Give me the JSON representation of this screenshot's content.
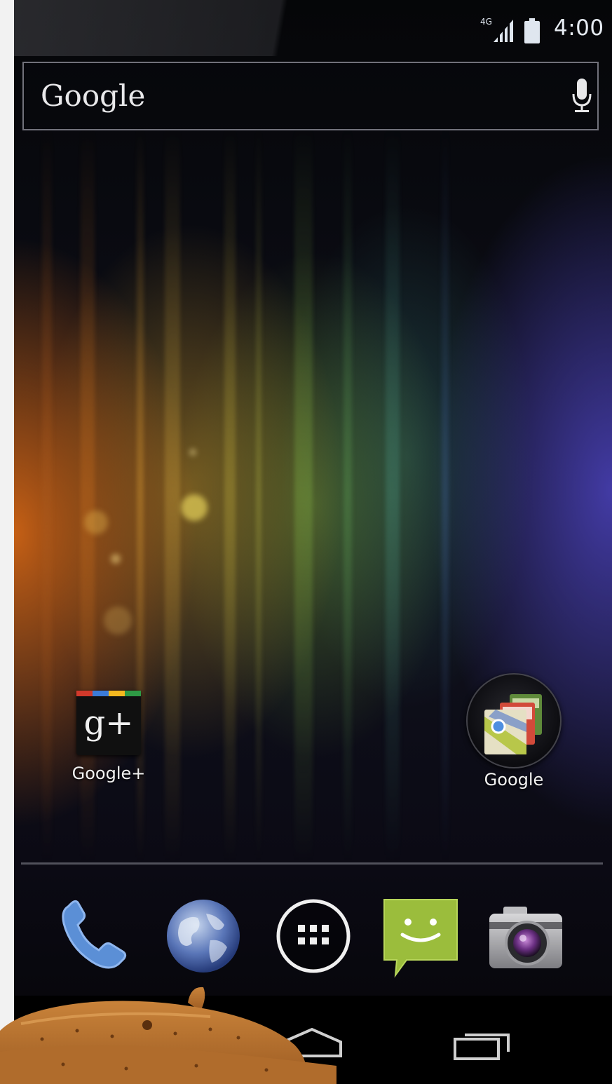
{
  "status_bar": {
    "network": "4G",
    "time": "4:00"
  },
  "search": {
    "logo_text": "Google"
  },
  "home": {
    "apps": [
      {
        "label": "Google+",
        "tile_text": "g+",
        "icon": "google-plus-icon"
      },
      {
        "label": "Google",
        "icon": "google-folder-icon"
      }
    ]
  },
  "dock": {
    "items": [
      {
        "icon": "phone-icon"
      },
      {
        "icon": "browser-globe-icon"
      },
      {
        "icon": "all-apps-icon"
      },
      {
        "icon": "messaging-icon"
      },
      {
        "icon": "camera-icon"
      }
    ]
  },
  "nav": {
    "buttons": [
      {
        "icon": "home-icon"
      },
      {
        "icon": "recent-apps-icon"
      }
    ]
  },
  "colors": {
    "gplus_red": "#d2392b",
    "gplus_blue": "#3b7bd8",
    "gplus_yellow": "#f3b81f",
    "gplus_green": "#2e9a45",
    "messaging_green": "#9bbd3c",
    "phone_blue": "#5b8fd6"
  }
}
